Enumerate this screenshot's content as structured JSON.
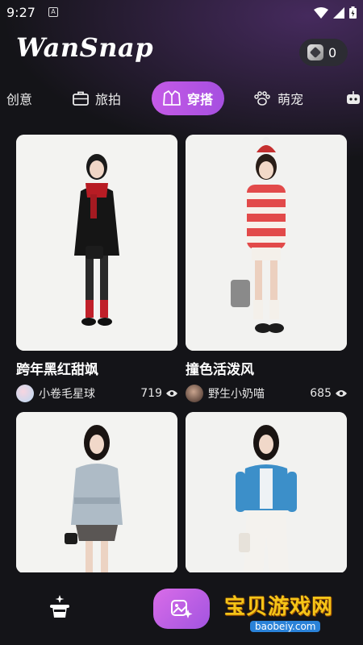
{
  "status_bar": {
    "time": "9:27",
    "app_icon_letter": "A"
  },
  "header": {
    "logo": "WanSnap",
    "coin_count": "0"
  },
  "tabs": [
    {
      "label": "创意",
      "icon": "none"
    },
    {
      "label": "旅拍",
      "icon": "suitcase-icon"
    },
    {
      "label": "穿搭",
      "icon": "jacket-icon",
      "active": true
    },
    {
      "label": "萌宠",
      "icon": "paw-icon"
    }
  ],
  "cards": [
    {
      "title": "跨年黑红甜飒",
      "author": "小卷毛星球",
      "views": "719",
      "outfit": "black coat, red scarf, red socks"
    },
    {
      "title": "撞色活泼风",
      "author": "野生小奶喵",
      "views": "685",
      "outfit": "red-white striped sweater, white shorts"
    },
    {
      "title": "",
      "author": "",
      "views": "",
      "outfit": "grey double-breasted coat, lace skirt"
    },
    {
      "title": "",
      "author": "",
      "views": "",
      "outfit": "blue cardigan, white jeans"
    }
  ],
  "watermark": {
    "text": "宝贝游戏网",
    "url": "baobeiy.com"
  },
  "colors": {
    "accent": "#b554e2",
    "background": "#141418",
    "card_bg": "#f2f2f0"
  }
}
